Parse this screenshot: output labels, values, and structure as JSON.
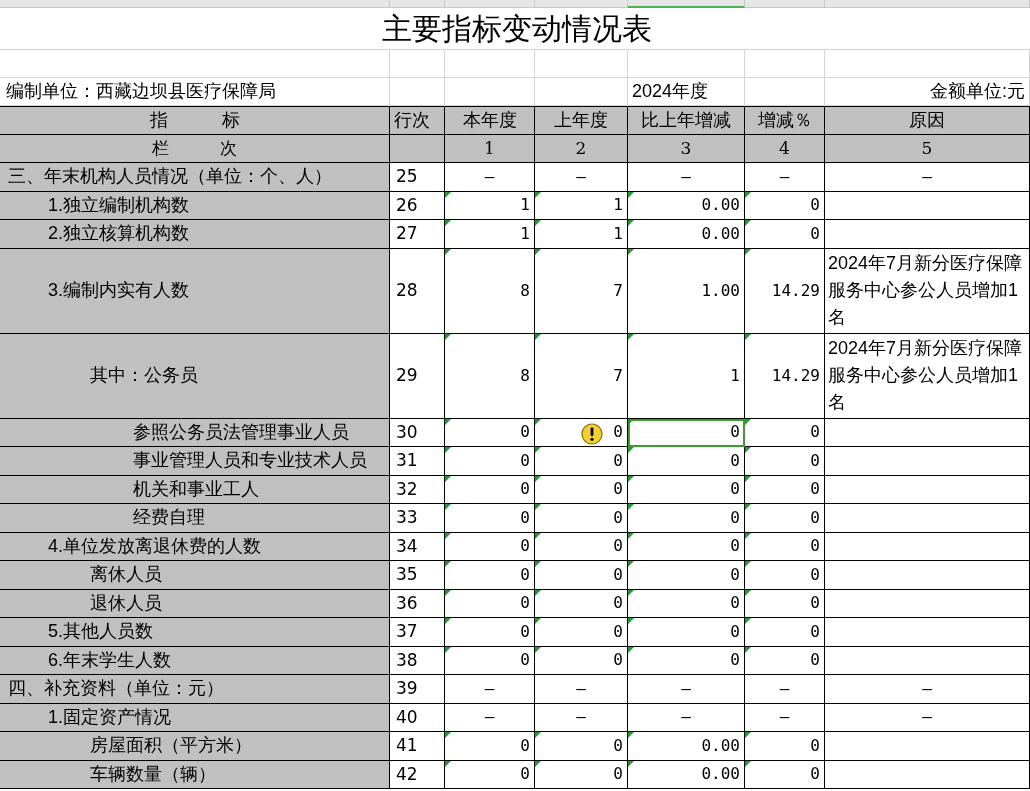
{
  "title": "主要指标变动情况表",
  "unit": "编制单位：西藏边坝县医疗保障局",
  "year": "2024年度",
  "currency": "金额单位:元",
  "header": [
    "指　　　标",
    "行次",
    "本年度",
    "上年度",
    "比上年增减",
    "增减％",
    "原因"
  ],
  "index_row": {
    "label": "栏　　　次",
    "numbers": [
      "1",
      "2",
      "3",
      "4",
      "5"
    ]
  },
  "rows": [
    {
      "label": "三、年末机构人员情况（单位：个、人）",
      "line": "25",
      "flagged": false,
      "cells": [
        {
          "text": "—",
          "selected": false,
          "warning": false
        },
        {
          "text": "—",
          "selected": false,
          "warning": false
        },
        {
          "text": "—",
          "selected": false,
          "warning": false
        },
        {
          "text": "—",
          "selected": false,
          "warning": false
        }
      ],
      "reason": "—",
      "children": [
        {
          "label": "1.独立编制机构数",
          "line": "26",
          "flagged": true,
          "cells": [
            {
              "text": "1",
              "selected": false,
              "warning": false
            },
            {
              "text": "1",
              "selected": false,
              "warning": false
            },
            {
              "text": "0.00",
              "selected": false,
              "warning": false
            },
            {
              "text": "0",
              "selected": false,
              "warning": false
            }
          ]
        },
        {
          "label": "2.独立核算机构数",
          "line": "27",
          "flagged": true,
          "cells": [
            {
              "text": "1",
              "selected": false,
              "warning": false
            },
            {
              "text": "1",
              "selected": false,
              "warning": false
            },
            {
              "text": "0.00",
              "selected": false,
              "warning": false
            },
            {
              "text": "0",
              "selected": false,
              "warning": false
            }
          ]
        },
        {
          "label": "3.编制内实有人数",
          "line": "28",
          "flagged": true,
          "cells": [
            {
              "text": "8",
              "selected": false,
              "warning": false
            },
            {
              "text": "7",
              "selected": false,
              "warning": false
            },
            {
              "text": "1.00",
              "selected": false,
              "warning": false
            },
            {
              "text": "14.29",
              "selected": false,
              "warning": false
            }
          ],
          "reason": "2024年7月新分医疗保障服务中心参公人员增加1名",
          "children": [
            {
              "label": "其中：公务员",
              "line": "29",
              "flagged": true,
              "cells": [
                {
                  "text": "8",
                  "selected": false,
                  "warning": false
                },
                {
                  "text": "7",
                  "selected": false,
                  "warning": false
                },
                {
                  "text": "1",
                  "selected": false,
                  "warning": false
                },
                {
                  "text": "14.29",
                  "selected": false,
                  "warning": false
                }
              ],
              "reason": "2024年7月新分医疗保障服务中心参公人员增加1名",
              "children": [
                {
                  "label": "参照公务员法管理事业人员",
                  "line": "30",
                  "flagged": true,
                  "cells": [
                    {
                      "text": "0",
                      "selected": false,
                      "warning": false
                    },
                    {
                      "text": "0",
                      "selected": false,
                      "warning": true
                    },
                    {
                      "text": "0",
                      "selected": true,
                      "warning": false
                    },
                    {
                      "text": "0",
                      "selected": false,
                      "warning": false
                    }
                  ]
                },
                {
                  "label": "事业管理人员和专业技术人员",
                  "line": "31",
                  "flagged": true,
                  "cells": [
                    {
                      "text": "0",
                      "selected": false,
                      "warning": false
                    },
                    {
                      "text": "0",
                      "selected": false,
                      "warning": false
                    },
                    {
                      "text": "0",
                      "selected": false,
                      "warning": false
                    },
                    {
                      "text": "0",
                      "selected": false,
                      "warning": false
                    }
                  ]
                },
                {
                  "label": "机关和事业工人",
                  "line": "32",
                  "flagged": true,
                  "cells": [
                    {
                      "text": "0",
                      "selected": false,
                      "warning": false
                    },
                    {
                      "text": "0",
                      "selected": false,
                      "warning": false
                    },
                    {
                      "text": "0",
                      "selected": false,
                      "warning": false
                    },
                    {
                      "text": "0",
                      "selected": false,
                      "warning": false
                    }
                  ]
                },
                {
                  "label": "经费自理",
                  "line": "33",
                  "flagged": true,
                  "cells": [
                    {
                      "text": "0",
                      "selected": false,
                      "warning": false
                    },
                    {
                      "text": "0",
                      "selected": false,
                      "warning": false
                    },
                    {
                      "text": "0",
                      "selected": false,
                      "warning": false
                    },
                    {
                      "text": "0",
                      "selected": false,
                      "warning": false
                    }
                  ]
                }
              ]
            }
          ]
        },
        {
          "label": "4.单位发放离退休费的人数",
          "line": "34",
          "flagged": true,
          "cells": [
            {
              "text": "0",
              "selected": false,
              "warning": false
            },
            {
              "text": "0",
              "selected": false,
              "warning": false
            },
            {
              "text": "0",
              "selected": false,
              "warning": false
            },
            {
              "text": "0",
              "selected": false,
              "warning": false
            }
          ],
          "children": [
            {
              "label": "离休人员",
              "line": "35",
              "flagged": true,
              "cells": [
                {
                  "text": "0",
                  "selected": false,
                  "warning": false
                },
                {
                  "text": "0",
                  "selected": false,
                  "warning": false
                },
                {
                  "text": "0",
                  "selected": false,
                  "warning": false
                },
                {
                  "text": "0",
                  "selected": false,
                  "warning": false
                }
              ]
            },
            {
              "label": "退休人员",
              "line": "36",
              "flagged": true,
              "cells": [
                {
                  "text": "0",
                  "selected": false,
                  "warning": false
                },
                {
                  "text": "0",
                  "selected": false,
                  "warning": false
                },
                {
                  "text": "0",
                  "selected": false,
                  "warning": false
                },
                {
                  "text": "0",
                  "selected": false,
                  "warning": false
                }
              ]
            }
          ]
        },
        {
          "label": "5.其他人员数",
          "line": "37",
          "flagged": true,
          "cells": [
            {
              "text": "0",
              "selected": false,
              "warning": false
            },
            {
              "text": "0",
              "selected": false,
              "warning": false
            },
            {
              "text": "0",
              "selected": false,
              "warning": false
            },
            {
              "text": "0",
              "selected": false,
              "warning": false
            }
          ]
        },
        {
          "label": "6.年末学生人数",
          "line": "38",
          "flagged": true,
          "cells": [
            {
              "text": "0",
              "selected": false,
              "warning": false
            },
            {
              "text": "0",
              "selected": false,
              "warning": false
            },
            {
              "text": "0",
              "selected": false,
              "warning": false
            },
            {
              "text": "0",
              "selected": false,
              "warning": false
            }
          ]
        }
      ]
    },
    {
      "label": "四、补充资料（单位：元）",
      "line": "39",
      "flagged": false,
      "cells": [
        {
          "text": "—",
          "selected": false,
          "warning": false
        },
        {
          "text": "—",
          "selected": false,
          "warning": false
        },
        {
          "text": "—",
          "selected": false,
          "warning": false
        },
        {
          "text": "—",
          "selected": false,
          "warning": false
        }
      ],
      "reason": "—",
      "children": [
        {
          "label": "1.固定资产情况",
          "line": "40",
          "flagged": false,
          "cells": [
            {
              "text": "—",
              "selected": false,
              "warning": false
            },
            {
              "text": "—",
              "selected": false,
              "warning": false
            },
            {
              "text": "—",
              "selected": false,
              "warning": false
            },
            {
              "text": "—",
              "selected": false,
              "warning": false
            }
          ],
          "reason": "—",
          "children": [
            {
              "label": "房屋面积（平方米）",
              "line": "41",
              "flagged": true,
              "cells": [
                {
                  "text": "0",
                  "selected": false,
                  "warning": false
                },
                {
                  "text": "0",
                  "selected": false,
                  "warning": false
                },
                {
                  "text": "0.00",
                  "selected": false,
                  "warning": false
                },
                {
                  "text": "0",
                  "selected": false,
                  "warning": false
                }
              ]
            },
            {
              "label": "车辆数量（辆）",
              "line": "42",
              "flagged": true,
              "cells": [
                {
                  "text": "0",
                  "selected": false,
                  "warning": false
                },
                {
                  "text": "0",
                  "selected": false,
                  "warning": false
                },
                {
                  "text": "0.00",
                  "selected": false,
                  "warning": false
                },
                {
                  "text": "0",
                  "selected": false,
                  "warning": false
                }
              ]
            }
          ]
        }
      ]
    }
  ]
}
